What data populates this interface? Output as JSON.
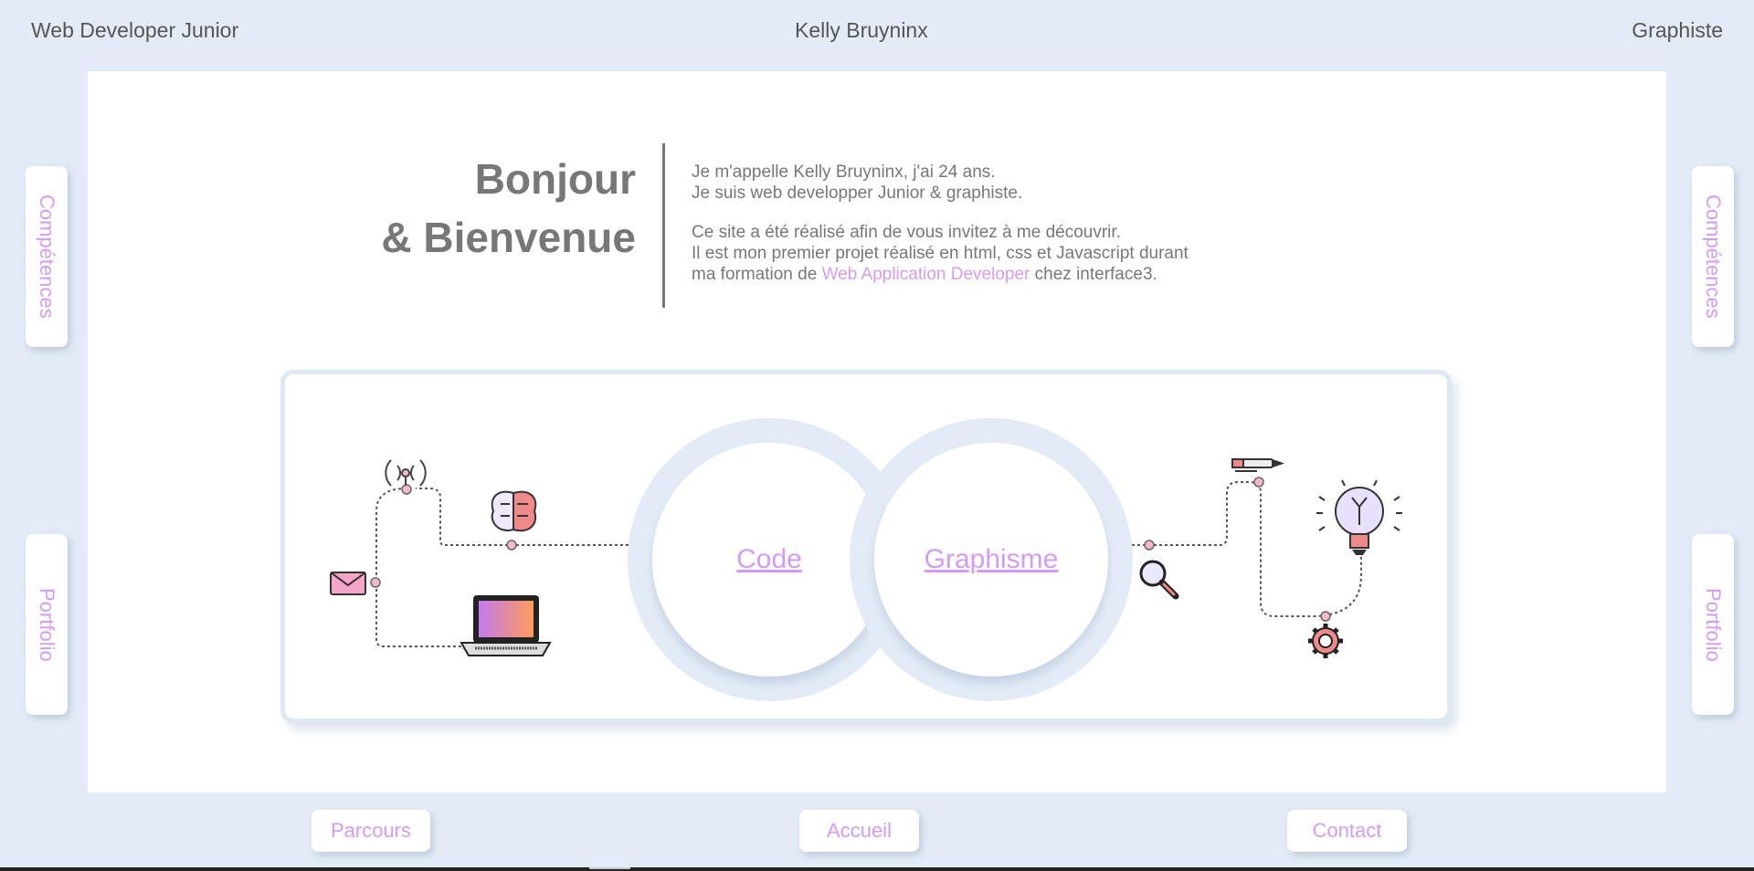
{
  "header": {
    "left": "Web Developer Junior",
    "center": "Kelly Bruyninx",
    "right": "Graphiste"
  },
  "side_nav": {
    "left_top": "Compétences",
    "left_bottom": "Portfolio",
    "right_top": "Compétences",
    "right_bottom": "Portfolio"
  },
  "welcome": {
    "line1": "Bonjour",
    "line2": "& Bienvenue"
  },
  "intro": {
    "p1_line1": "Je m'appelle Kelly Bruyninx, j'ai 24 ans.",
    "p1_line2": "Je suis web developper Junior & graphiste.",
    "p2_line1": "Ce site a été réalisé afin de vous invitez à me découvrir.",
    "p2_line2": "Il est mon premier projet réalisé en html, css et Javascript durant",
    "p2_line3_pre": "ma formation de ",
    "p2_line3_link": "Web Application Developer",
    "p2_line3_post": " chez interface3."
  },
  "rings": {
    "code": "Code",
    "graphisme": "Graphisme"
  },
  "icons_left": [
    "antenna-icon",
    "brain-icon",
    "envelope-icon",
    "laptop-icon"
  ],
  "icons_right": [
    "pencil-icon",
    "lightbulb-icon",
    "magnifier-icon",
    "gear-icon"
  ],
  "bottom_nav": {
    "parcours": "Parcours",
    "accueil": "Accueil",
    "contact": "Contact"
  },
  "colors": {
    "background": "#e3ecf6",
    "accent": "#d59af2",
    "text": "#777777"
  }
}
